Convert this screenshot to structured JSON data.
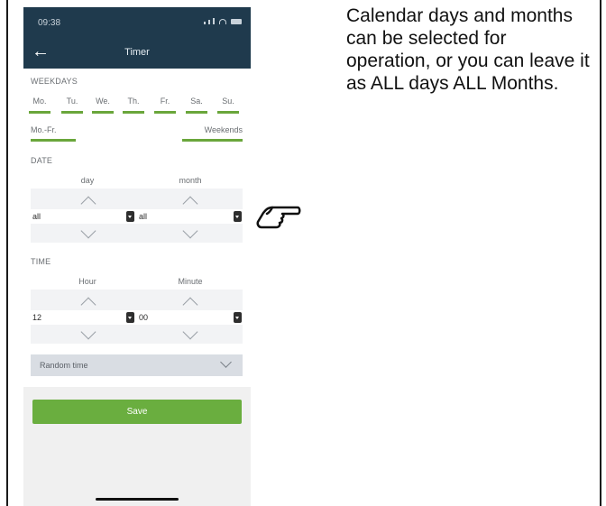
{
  "status_bar": {
    "time": "09:38"
  },
  "header": {
    "title": "Timer"
  },
  "weekdays": {
    "label": "WEEKDAYS",
    "days": [
      "Mo.",
      "Tu.",
      "We.",
      "Th.",
      "Fr.",
      "Sa.",
      "Su."
    ],
    "mo_fr": "Mo.-Fr.",
    "weekends": "Weekends"
  },
  "date": {
    "label": "DATE",
    "day_header": "day",
    "month_header": "month",
    "day_value": "all",
    "month_value": "all"
  },
  "time": {
    "label": "TIME",
    "hour_header": "Hour",
    "minute_header": "Minute",
    "hour_value": "12",
    "minute_value": "00"
  },
  "random_time": {
    "label": "Random time"
  },
  "save": {
    "label": "Save"
  },
  "instructions": "Calendar days and months can be selected for operation, or you can leave it as ALL days ALL Months.",
  "colors": {
    "header_bg": "#1f3a4d",
    "accent_green": "#6aae3f",
    "underline_green": "#6aa63b"
  },
  "icons": [
    "back-arrow-icon",
    "signal-icon",
    "wifi-icon",
    "battery-icon",
    "chevron-up-icon",
    "chevron-down-icon",
    "dropdown-icon",
    "pointing-hand-icon"
  ]
}
